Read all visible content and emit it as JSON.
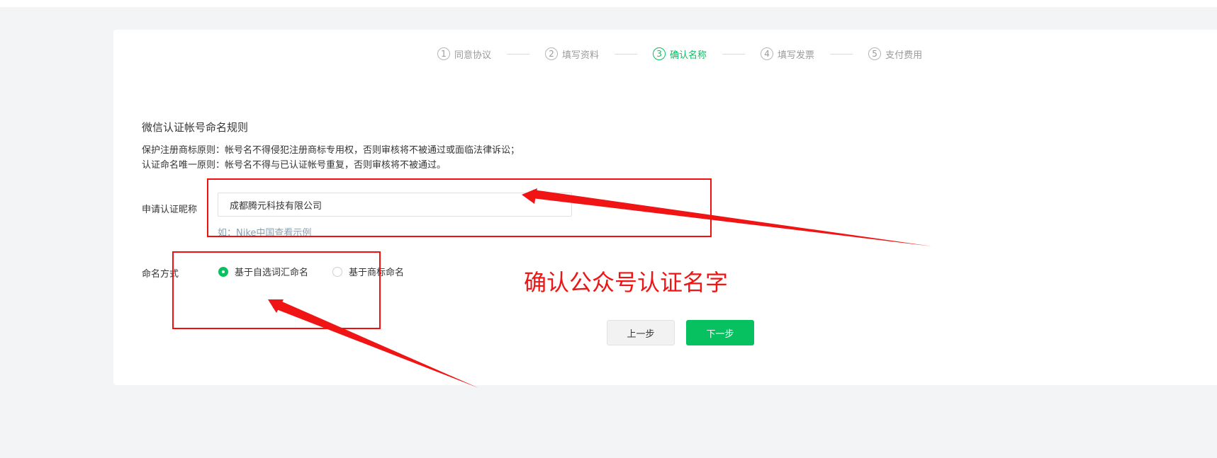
{
  "steps": [
    {
      "num": "1",
      "label": "同意协议",
      "active": false
    },
    {
      "num": "2",
      "label": "填写资料",
      "active": false
    },
    {
      "num": "3",
      "label": "确认名称",
      "active": true
    },
    {
      "num": "4",
      "label": "填写发票",
      "active": false
    },
    {
      "num": "5",
      "label": "支付费用",
      "active": false
    }
  ],
  "rules": {
    "title": "微信认证帐号命名规则",
    "items": [
      "保护注册商标原则：帐号名不得侵犯注册商标专用权，否则审核将不被通过或面临法律诉讼；",
      "认证命名唯一原则：帐号名不得与已认证帐号重复，否则审核将不被通过。"
    ]
  },
  "form": {
    "name_label": "申请认证昵称",
    "name_value": "成都腾元科技有限公司",
    "name_hint": "如：Nike中国查看示例",
    "mode_label": "命名方式",
    "mode_options": [
      {
        "label": "基于自选词汇命名",
        "checked": true
      },
      {
        "label": "基于商标命名",
        "checked": false
      }
    ]
  },
  "buttons": {
    "prev": "上一步",
    "next": "下一步"
  },
  "annotation": {
    "text": "确认公众号认证名字",
    "color": "#f01414"
  },
  "colors": {
    "accent": "#07c160",
    "background": "#f3f4f6"
  }
}
